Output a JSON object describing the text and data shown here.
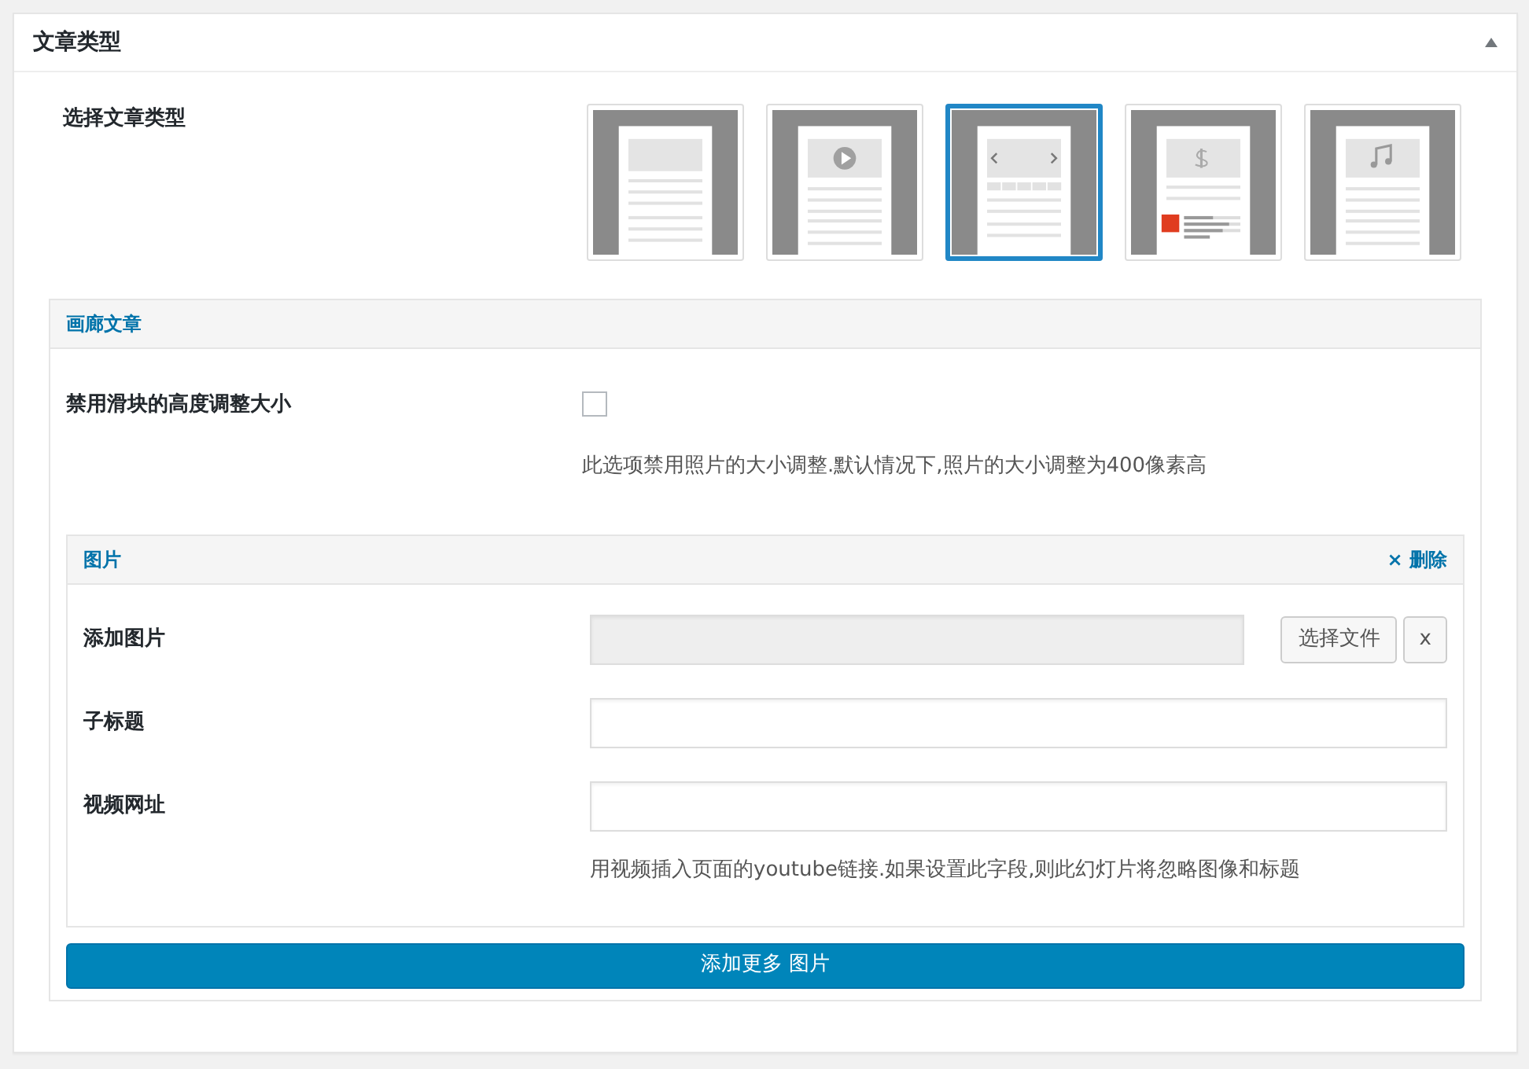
{
  "panel": {
    "title": "文章类型"
  },
  "format": {
    "label": "选择文章类型",
    "options": [
      {
        "kind": "standard",
        "selected": false
      },
      {
        "kind": "video",
        "selected": false
      },
      {
        "kind": "gallery",
        "selected": true
      },
      {
        "kind": "review",
        "selected": false
      },
      {
        "kind": "audio",
        "selected": false
      }
    ]
  },
  "gallery": {
    "title": "画廊文章",
    "disable_resize": {
      "label": "禁用滑块的高度调整大小",
      "checked": false,
      "description": "此选项禁用照片的大小调整.默认情况下,照片的大小调整为400像素高"
    },
    "slides": [
      {
        "title": "图片",
        "remove": "× 删除",
        "fields": [
          {
            "kind": "file",
            "label": "添加图片",
            "choose_button": "选择文件",
            "clear_button": "x"
          },
          {
            "kind": "text",
            "label": "子标题"
          },
          {
            "kind": "text",
            "label": "视频网址",
            "description": "用视频插入页面的youtube链接.如果设置此字段,则此幻灯片将忽略图像和标题"
          }
        ]
      }
    ],
    "add_more": "添加更多 图片"
  }
}
